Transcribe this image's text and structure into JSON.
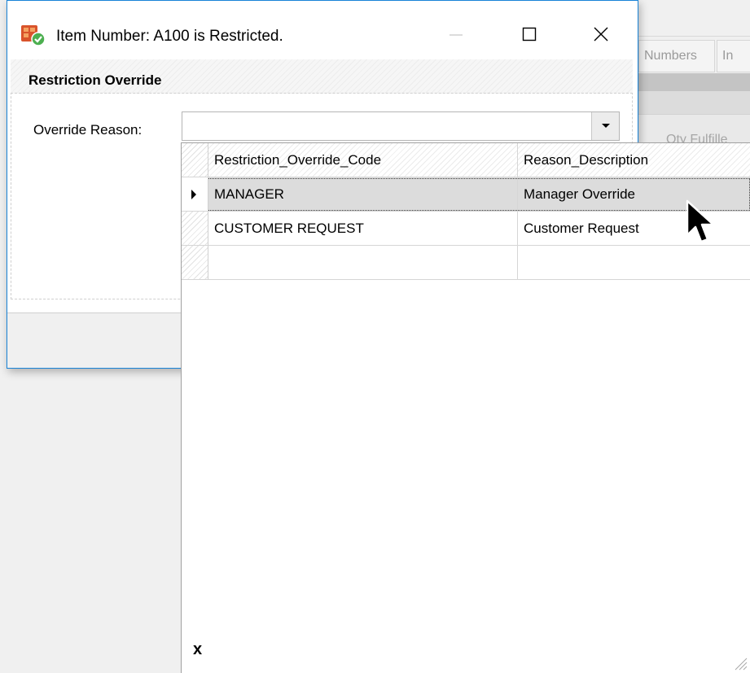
{
  "dialog": {
    "title": "Item Number: A100 is Restricted.",
    "group_title": "Restriction Override",
    "field_label": "Override Reason:",
    "field_value": ""
  },
  "dropdown": {
    "columns": [
      "Restriction_Override_Code",
      "Reason_Description"
    ],
    "rows": [
      {
        "code": "MANAGER",
        "description": "Manager Override",
        "selected": true
      },
      {
        "code": "CUSTOMER REQUEST",
        "description": "Customer Request",
        "selected": false
      },
      {
        "code": "",
        "description": "",
        "selected": false
      }
    ],
    "close_label": "x"
  },
  "background": {
    "tabs": [
      "Numbers",
      "In"
    ],
    "grid_header": "Qty Fulfille"
  },
  "colors": {
    "window_border": "#1883d7",
    "selected_row": "#dcdcdc",
    "app_icon_primary": "#d9532b",
    "app_icon_secondary": "#4caf50"
  }
}
